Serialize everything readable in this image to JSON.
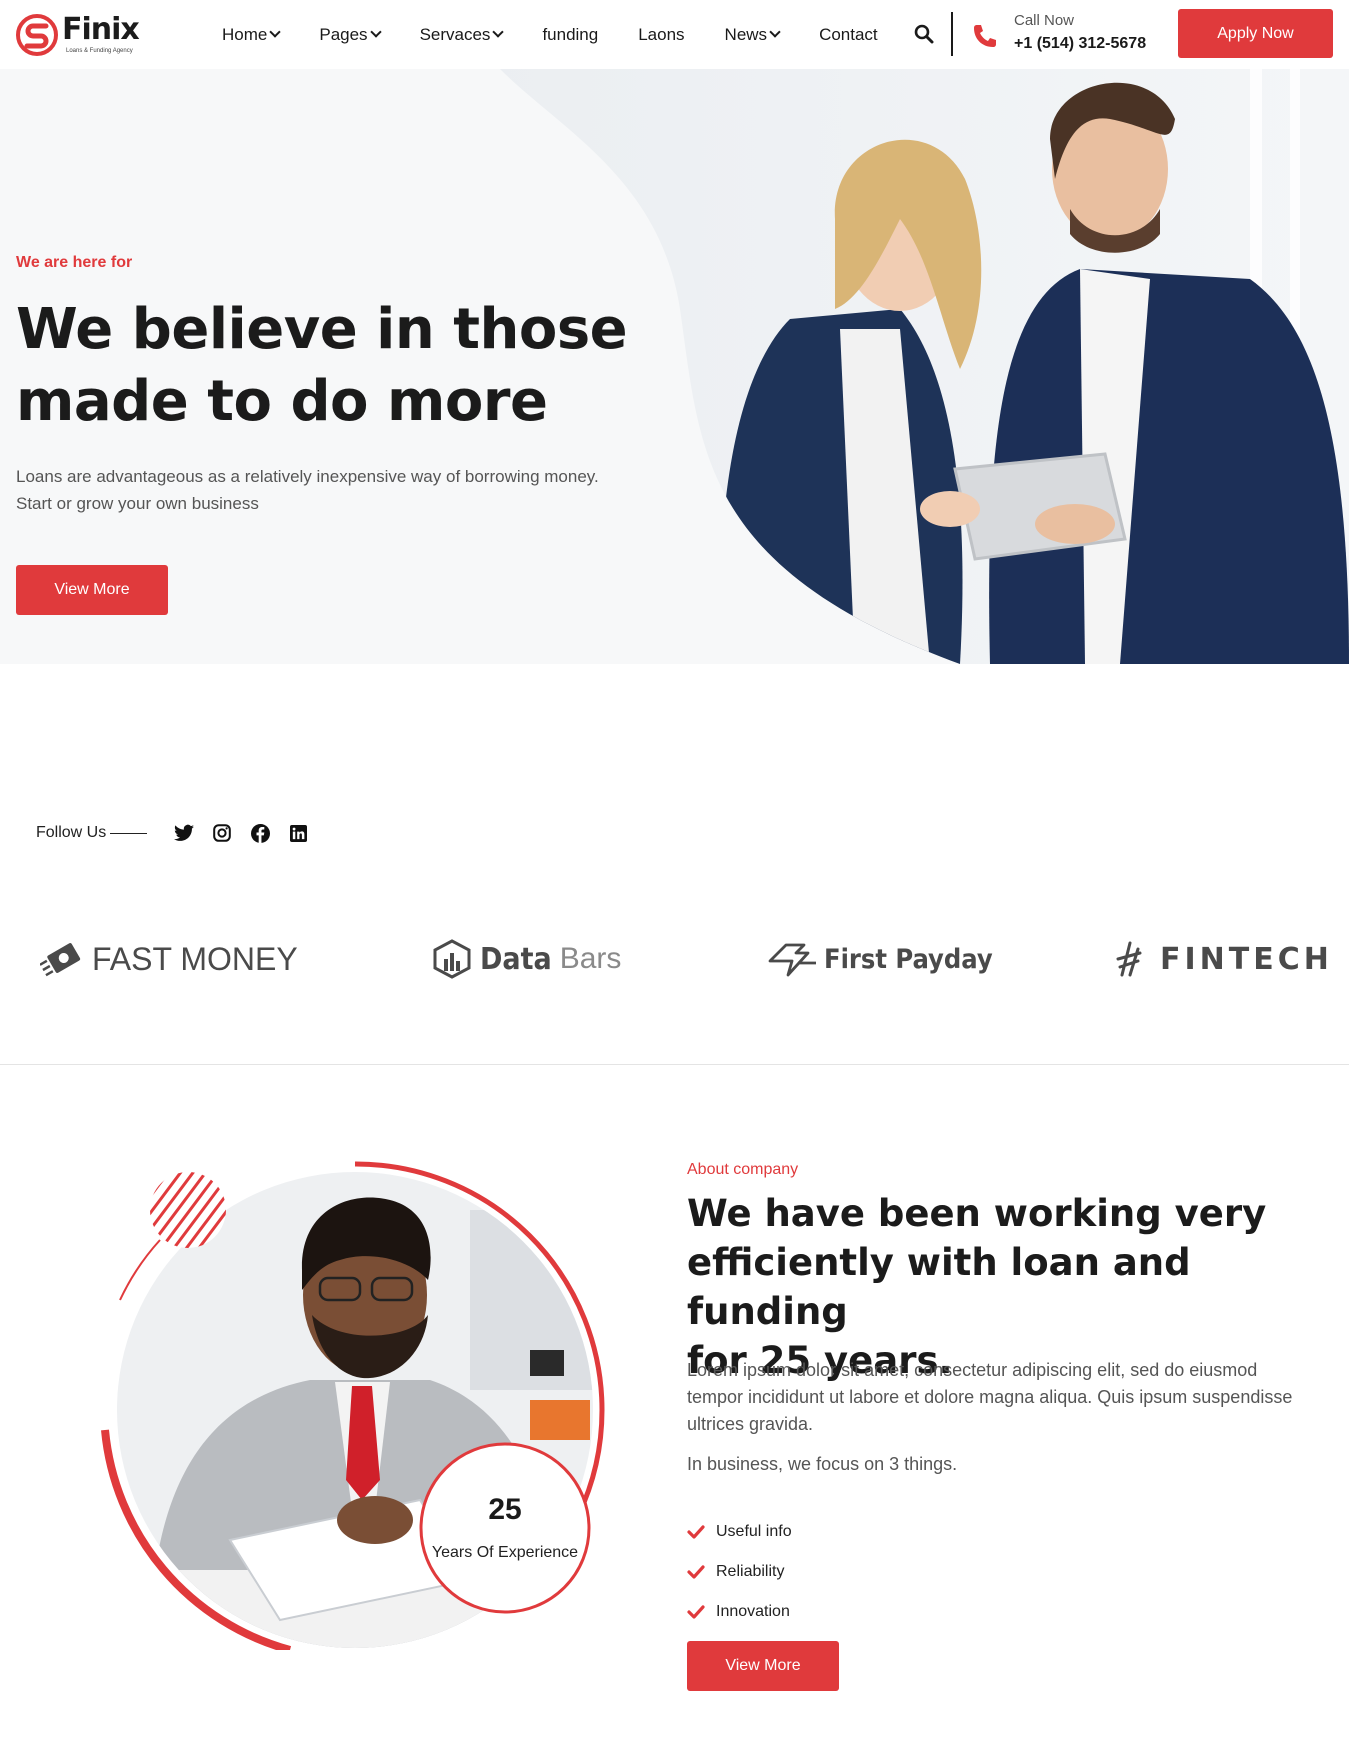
{
  "brand": {
    "name": "Finix",
    "tagline": "Loans & Funding Agency",
    "accent_color": "#e03a3c",
    "logo_icon": "finix-s-mark-icon"
  },
  "nav": {
    "items": [
      {
        "label": "Home",
        "has_dropdown": true
      },
      {
        "label": "Pages",
        "has_dropdown": true
      },
      {
        "label": "Servaces",
        "has_dropdown": true
      },
      {
        "label": "funding",
        "has_dropdown": false
      },
      {
        "label": "Laons",
        "has_dropdown": false
      },
      {
        "label": "News",
        "has_dropdown": true
      },
      {
        "label": "Contact",
        "has_dropdown": false
      }
    ],
    "search_icon": "search-icon"
  },
  "call": {
    "label": "Call Now",
    "number": "+1 (514) 312-5678",
    "icon": "phone-icon"
  },
  "header": {
    "apply_label": "Apply Now"
  },
  "hero": {
    "eyebrow": "We are here for",
    "title_line1": "We believe in those",
    "title_line2": "made to do more",
    "desc_line1": "Loans are advantageous as a relatively inexpensive way of borrowing money.",
    "desc_line2": "Start or grow your own business",
    "button_label": "View More",
    "photo": "business-people-tablet-photo"
  },
  "follow": {
    "label": "Follow Us",
    "icons": [
      "twitter-icon",
      "instagram-icon",
      "facebook-icon",
      "linkedin-icon"
    ]
  },
  "brands": [
    {
      "name": "FAST MONEY",
      "icon": "fast-money-logo-icon"
    },
    {
      "name_part1": "Data",
      "name_part2": "Bars",
      "icon": "data-bars-logo-icon"
    },
    {
      "name": "First Payday",
      "icon": "first-payday-logo-icon"
    },
    {
      "name": "FINTECH",
      "icon": "fintech-logo-icon"
    }
  ],
  "about": {
    "eyebrow": "About company",
    "title_line1": "We have been working very",
    "title_line2": "efficiently with loan and funding",
    "title_line3": "for 25 years.",
    "desc_line1": "Lorem ipsum dolor sit amet, consectetur adipiscing elit, sed do eiusmod",
    "desc_line2": "tempor incididunt ut labore et dolore magna aliqua. Quis ipsum suspendisse",
    "desc_line3": "ultrices gravida.",
    "focus": "In business, we focus on 3 things.",
    "checklist": [
      "Useful info",
      "Reliability",
      "Innovation"
    ],
    "button_label": "View More",
    "experience_number": "25",
    "experience_label": "Years Of Experience",
    "photo": "man-signing-document-photo"
  }
}
